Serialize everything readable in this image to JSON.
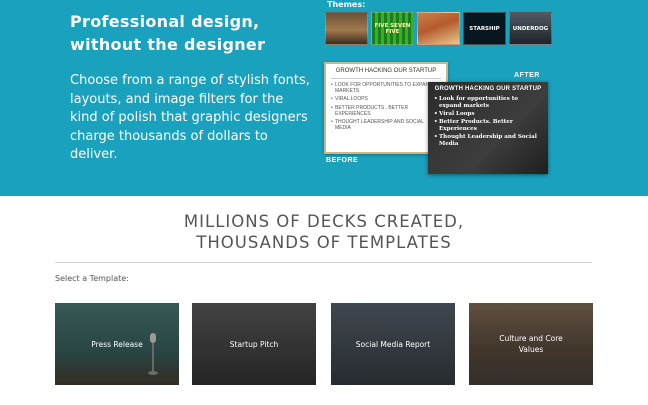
{
  "hero": {
    "headline": "Professional design, without the designer",
    "body": "Choose from a range of stylish fonts, layouts, and image filters for the kind of polish that graphic designers charge thousands of dollars to deliver.",
    "themes_label": "Themes:",
    "themes": [
      {
        "label": ""
      },
      {
        "label": "FIVE SEVEN FIVE"
      },
      {
        "label": ""
      },
      {
        "label": "STARSHIP"
      },
      {
        "label": "UNDERDOG"
      }
    ],
    "before_label": "BEFORE",
    "after_label": "AFTER",
    "before_card": {
      "title": "GROWTH HACKING OUR STARTUP",
      "items": [
        "Look for opportunities to expand markets",
        "Viral Loops",
        "Better Products , Better Experiences",
        "Thought Leadership and Social Media"
      ]
    },
    "after_card": {
      "title": "GROWTH HACKING OUR STARTUP",
      "items": [
        "Look for opportunities to expand markets",
        "Viral Loops",
        "Better Products. Better Experiences",
        "Thought Leadership and Social Media"
      ]
    }
  },
  "main": {
    "title_line1": "MILLIONS OF DECKS CREATED,",
    "title_line2": "THOUSANDS OF TEMPLATES",
    "select_label": "Select a Template:",
    "templates": [
      {
        "label": "Press Release"
      },
      {
        "label": "Startup Pitch"
      },
      {
        "label": "Social Media Report"
      },
      {
        "label": "Culture and Core Values"
      }
    ]
  }
}
